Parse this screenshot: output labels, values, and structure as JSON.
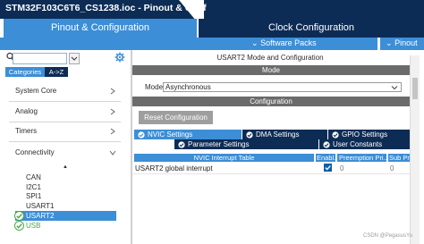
{
  "window": {
    "title": "STM32F103C6T6_CS1238.ioc - Pinout & Conf"
  },
  "main_tabs": {
    "pinout": "Pinout & Configuration",
    "clock": "Clock Configuration"
  },
  "subbar": {
    "software_packs": "Software Packs",
    "pinout": "Pinout"
  },
  "left": {
    "search": {
      "value": "",
      "placeholder": ""
    },
    "toggle": {
      "categories": "Categories",
      "az": "A->Z"
    },
    "categories": [
      "System Core",
      "Analog",
      "Timers",
      "Connectivity"
    ],
    "peripherals": [
      "CAN",
      "I2C1",
      "SPI1",
      "USART1",
      "USART2",
      "USB"
    ],
    "selected": "USART2"
  },
  "right": {
    "panel_title": "USART2 Mode and Configuration",
    "mode_header": "Mode",
    "mode_label": "Mode",
    "mode_value": "Asynchronous",
    "configuration_header": "Configuration",
    "reset_button": "Reset Configuration",
    "settings_tabs": [
      "NVIC Settings",
      "DMA Settings",
      "GPIO Settings",
      "Parameter Settings",
      "User Constants"
    ],
    "table_headers": [
      "NVIC Interrupt Table",
      "Enabl...",
      "Preemption Pri...",
      "Sub Prio..."
    ],
    "table_rows": [
      {
        "name": "USART2 global interrupt",
        "enabled": true,
        "preemption": "0",
        "sub": "0"
      }
    ]
  },
  "watermark": "CSDN @PegasusYu",
  "colors": {
    "navy": "#0c2c55",
    "accent": "#3c8ed7",
    "gray_header": "#6b6b6b",
    "ok_green": "#48a848"
  }
}
